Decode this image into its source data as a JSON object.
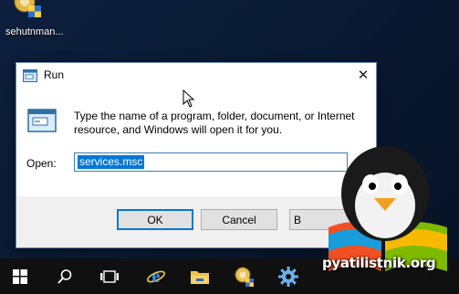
{
  "desktop": {
    "icon_label": "sehutnman..."
  },
  "dialog": {
    "title": "Run",
    "description": "Type the name of a program, folder, document, or Internet resource, and Windows will open it for you.",
    "open_label": "Open:",
    "open_value": "services.msc",
    "ok_label": "OK",
    "cancel_label": "Cancel",
    "browse_label": "B"
  },
  "taskbar": {
    "items": [
      "start-icon",
      "search-icon",
      "task-view-icon",
      "internet-explorer-icon",
      "file-explorer-icon",
      "server-manager-icon",
      "services-gear-icon"
    ]
  },
  "watermark": {
    "text": "pyatilistnik.org"
  },
  "colors": {
    "selection": "#0078d7",
    "taskbar": "#101010",
    "dialog_footer": "#f0f0f0"
  }
}
